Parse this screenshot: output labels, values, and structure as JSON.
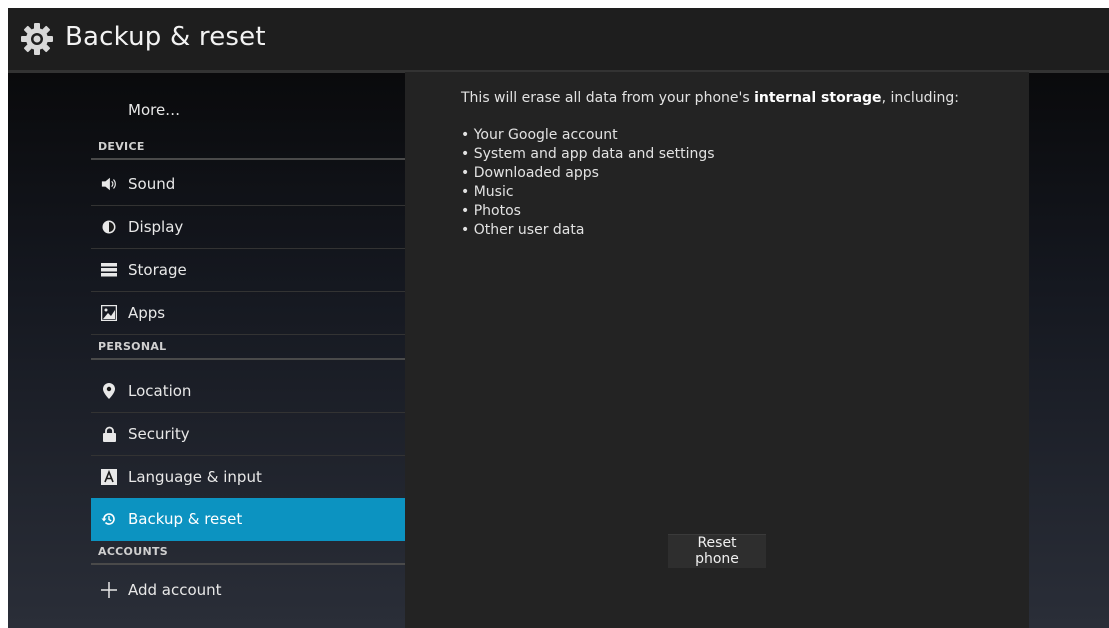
{
  "actionbar": {
    "title": "Backup & reset",
    "icon": "gear-icon"
  },
  "sidebar": {
    "more_label": "More…",
    "sections": {
      "device": "DEVICE",
      "personal": "PERSONAL",
      "accounts": "ACCOUNTS"
    },
    "items": [
      {
        "label": "Sound",
        "icon": "speaker-icon"
      },
      {
        "label": "Display",
        "icon": "brightness-icon"
      },
      {
        "label": "Storage",
        "icon": "storage-icon"
      },
      {
        "label": "Apps",
        "icon": "apps-icon"
      },
      {
        "label": "Location",
        "icon": "location-pin-icon"
      },
      {
        "label": "Security",
        "icon": "lock-icon"
      },
      {
        "label": "Language & input",
        "icon": "keyboard-icon"
      },
      {
        "label": "Backup & reset",
        "icon": "backup-restore-icon",
        "selected": true
      },
      {
        "label": "Add account",
        "icon": "plus-icon"
      }
    ]
  },
  "content": {
    "intro_prefix": "This will erase all data from your phone's ",
    "intro_bold": "internal storage",
    "intro_suffix": ", including:",
    "bullets": [
      "Your Google account",
      "System and app data and settings",
      "Downloaded apps",
      "Music",
      "Photos",
      "Other user data"
    ],
    "reset_button": "Reset phone"
  },
  "colors": {
    "selected": "#0c93c1",
    "actionbar": "#1e1e1e",
    "content_bg": "#232323"
  }
}
